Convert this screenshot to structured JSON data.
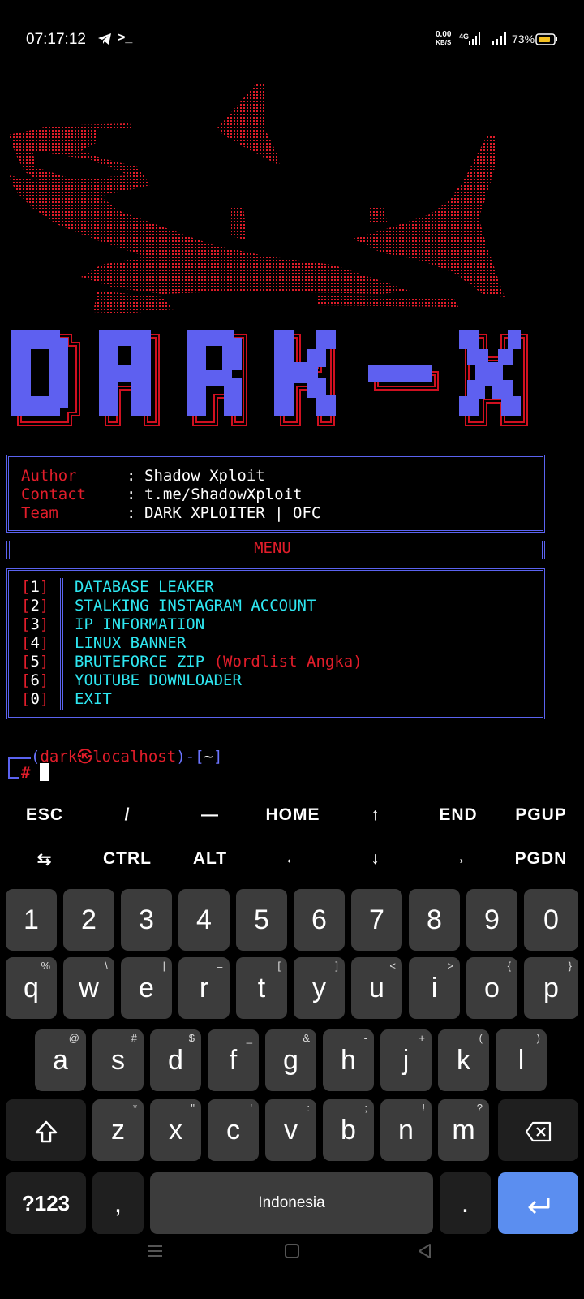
{
  "status_bar": {
    "time": "07:17:12",
    "net_speed": "0.00",
    "net_unit": "KB/S",
    "network": "4G",
    "battery": "73%",
    "icons": [
      "telegram-icon",
      "terminal-icon",
      "signal-icon",
      "battery-icon"
    ]
  },
  "banner": {
    "logo_text": "DARK-X",
    "art": "shark ascii art"
  },
  "info": {
    "rows": [
      {
        "label": "Author",
        "sep": ":",
        "value": "Shadow Xploit"
      },
      {
        "label": "Contact",
        "sep": ":",
        "value": "t.me/ShadowXploit"
      },
      {
        "label": "Team",
        "sep": ":",
        "value": "DARK XPLOITER | OFC"
      }
    ]
  },
  "menu": {
    "title": "MENU",
    "items": [
      {
        "num": "1",
        "label": "DATABASE LEAKER",
        "note": ""
      },
      {
        "num": "2",
        "label": "STALKING INSTAGRAM ACCOUNT",
        "note": ""
      },
      {
        "num": "3",
        "label": "IP INFORMATION",
        "note": ""
      },
      {
        "num": "4",
        "label": "LINUX BANNER",
        "note": ""
      },
      {
        "num": "5",
        "label": "BRUTEFORCE ZIP",
        "note": "(Wordlist Angka)"
      },
      {
        "num": "6",
        "label": "YOUTUBE DOWNLOADER",
        "note": ""
      },
      {
        "num": "0",
        "label": "EXIT",
        "note": ""
      }
    ]
  },
  "prompt": {
    "open": "(",
    "user": "dark",
    "at": "㉿",
    "host": "localhost",
    "close": ")",
    "dash": "-",
    "dir_open": "[",
    "dir": "~",
    "dir_close": "]",
    "symbol": "#"
  },
  "extra_keys": {
    "row1": [
      "ESC",
      "/",
      "—",
      "HOME",
      "↑",
      "END",
      "PGUP"
    ],
    "row2": [
      "⇆",
      "CTRL",
      "ALT",
      "←",
      "↓",
      "→",
      "PGDN"
    ]
  },
  "keyboard": {
    "numbers": [
      "1",
      "2",
      "3",
      "4",
      "5",
      "6",
      "7",
      "8",
      "9",
      "0"
    ],
    "row1": [
      {
        "k": "q",
        "s": "%"
      },
      {
        "k": "w",
        "s": "\\"
      },
      {
        "k": "e",
        "s": "|"
      },
      {
        "k": "r",
        "s": "="
      },
      {
        "k": "t",
        "s": "["
      },
      {
        "k": "y",
        "s": "]"
      },
      {
        "k": "u",
        "s": "<"
      },
      {
        "k": "i",
        "s": ">"
      },
      {
        "k": "o",
        "s": "{"
      },
      {
        "k": "p",
        "s": "}"
      }
    ],
    "row2": [
      {
        "k": "a",
        "s": "@"
      },
      {
        "k": "s",
        "s": "#"
      },
      {
        "k": "d",
        "s": "$"
      },
      {
        "k": "f",
        "s": "_"
      },
      {
        "k": "g",
        "s": "&"
      },
      {
        "k": "h",
        "s": "-"
      },
      {
        "k": "j",
        "s": "+"
      },
      {
        "k": "k",
        "s": "("
      },
      {
        "k": "l",
        "s": ")"
      }
    ],
    "row3": [
      {
        "k": "z",
        "s": "*"
      },
      {
        "k": "x",
        "s": "\""
      },
      {
        "k": "c",
        "s": "'"
      },
      {
        "k": "v",
        "s": ":"
      },
      {
        "k": "b",
        "s": ";"
      },
      {
        "k": "n",
        "s": "!"
      },
      {
        "k": "m",
        "s": "?"
      }
    ],
    "symbols_key": "?123",
    "comma": ",",
    "space_label": "Indonesia",
    "period": "."
  },
  "colors": {
    "accent_red": "#e11d2a",
    "accent_blue": "#5b63f0",
    "cyan": "#2ee6f0",
    "enter_key": "#5b8ef0"
  }
}
